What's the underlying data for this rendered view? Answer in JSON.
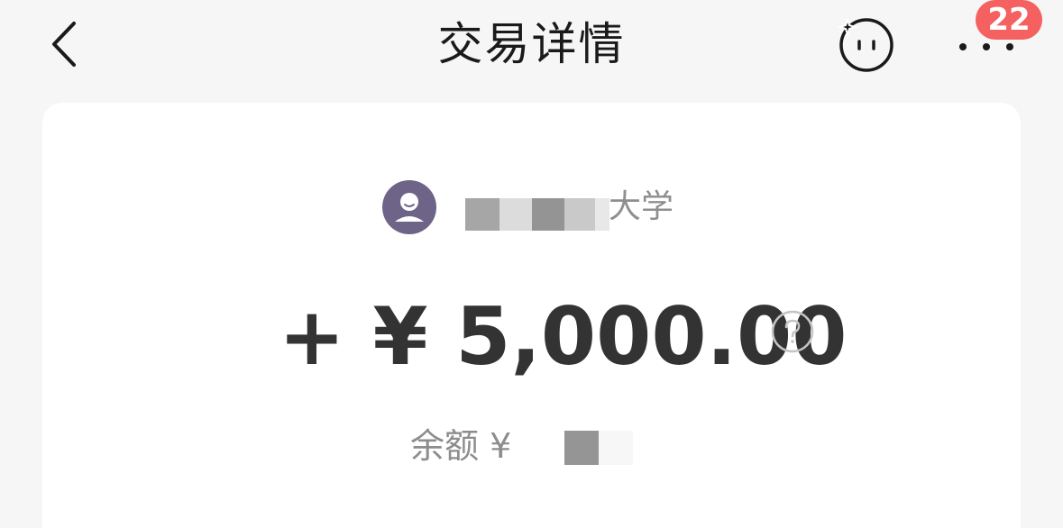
{
  "header": {
    "title": "交易详情",
    "back_icon": "chevron-left-icon",
    "assistant_icon": "smile-sparkle-icon",
    "more_icon": "more-dots-icon",
    "notification_count": "22"
  },
  "transaction": {
    "payer_name_suffix": "大学",
    "payer_name_redacted": true,
    "amount": "+ ¥ 5,000.00",
    "help_icon": "question-circle-icon",
    "balance_label": "余额 ¥",
    "balance_redacted": true
  },
  "colors": {
    "background": "#f6f6f6",
    "card": "#ffffff",
    "avatar": "#6e6487",
    "badge": "#f56060",
    "amount_text": "#333333",
    "secondary_text": "#8f8f8f"
  }
}
